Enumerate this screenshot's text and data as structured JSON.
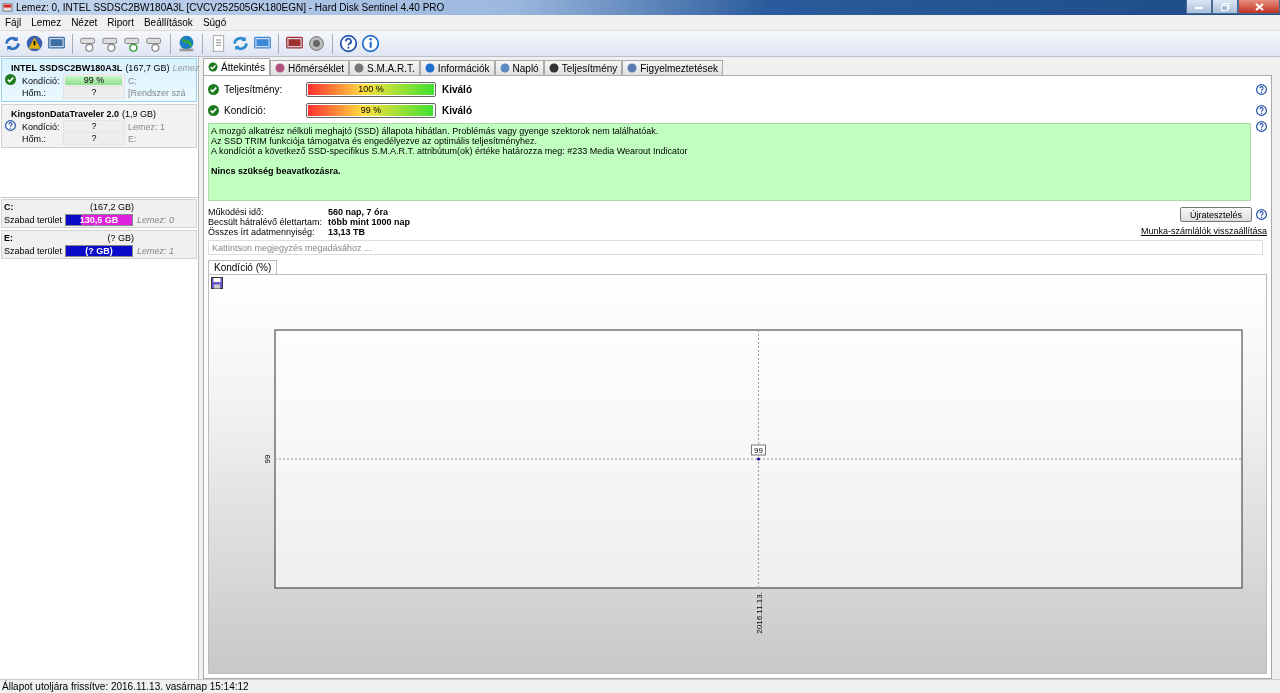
{
  "window": {
    "title": "Lemez: 0, INTEL SSDSC2BW180A3L [CVCV252505GK180EGN]  -  Hard Disk Sentinel 4.40 PRO"
  },
  "menu": [
    "Fájl",
    "Lemez",
    "Nézet",
    "Riport",
    "Beállítások",
    "Súgó"
  ],
  "disks": [
    {
      "name": "INTEL SSDSC2BW180A3L",
      "size": "(167,7 GB)",
      "tag": "Lemez",
      "selected": true,
      "kind": "ok",
      "rows": [
        {
          "label": "Kondíció:",
          "value": "99 %",
          "level": 0.99,
          "note": "C;"
        },
        {
          "label": "Hőm.:",
          "value": "?",
          "note": "[Rendszer szá"
        }
      ]
    },
    {
      "name": "KingstonDataTraveler 2.0",
      "size": "(1,9 GB)",
      "selected": false,
      "kind": "unknown",
      "rows": [
        {
          "label": "Kondíció:",
          "value": "?",
          "note": "Lemez: 1"
        },
        {
          "label": "Hőm.:",
          "value": "?",
          "note": "E:"
        }
      ]
    }
  ],
  "partitions": [
    {
      "drive": "C:",
      "size": "(167,2 GB)",
      "free_label": "Szabad terület",
      "free": "130,5 GB",
      "level": 0.78,
      "disk": "Lemez: 0"
    },
    {
      "drive": "E:",
      "size": "(? GB)",
      "free_label": "Szabad terület",
      "free": "(? GB)",
      "disk": "Lemez: 1"
    }
  ],
  "tabs": [
    {
      "label": "Áttekintés",
      "selected": true
    },
    {
      "label": "Hőmérséklet",
      "selected": false
    },
    {
      "label": "S.M.A.R.T.",
      "selected": false
    },
    {
      "label": "Információk",
      "selected": false
    },
    {
      "label": "Napló",
      "selected": false
    },
    {
      "label": "Teljesítmény",
      "selected": false
    },
    {
      "label": "Figyelmeztetések",
      "selected": false
    }
  ],
  "metrics": [
    {
      "label": "Teljesítmény:",
      "value": "100 %",
      "level": 1.0,
      "rating": "Kiváló"
    },
    {
      "label": "Kondíció:",
      "value": "99 %",
      "level": 0.99,
      "rating": "Kiváló"
    }
  ],
  "message": {
    "lines": [
      "A mozgó alkatrész nélküli meghajtó (SSD) állapota hibátlan. Problémás vagy gyenge szektorok nem találhatóak.",
      "Az SSD TRIM funkciója támogatva és engedélyezve az optimális teljesítményhez.",
      "A kondíciót a következő SSD-specifikus S.M.A.R.T. attribútum(ok) értéke határozza meg:  #233 Media Wearout Indicator"
    ],
    "conclusion": "Nincs szükség beavatkozásra."
  },
  "details": [
    {
      "label": "Működési idő:",
      "value": "560 nap, 7 óra"
    },
    {
      "label": "Becsült hátralévő élettartam:",
      "value": "több mint 1000 nap"
    },
    {
      "label": "Összes írt adatmennyiség:",
      "value": "13,13 TB"
    }
  ],
  "retest_button": "Újratesztelés",
  "reset_link": "Munka-számlálók visszaállítása",
  "note_field": {
    "placeholder": "Kattintson megjegyzés megadásához ..."
  },
  "chart_tab": "Kondíció  (%)",
  "condition_graph": {
    "y_marker": "99",
    "point_label": "99",
    "date_label": "2016.11.13."
  },
  "status_bar": "Állapot utoljára frissítve: 2016.11.13. vasárnap 15:14:12"
}
